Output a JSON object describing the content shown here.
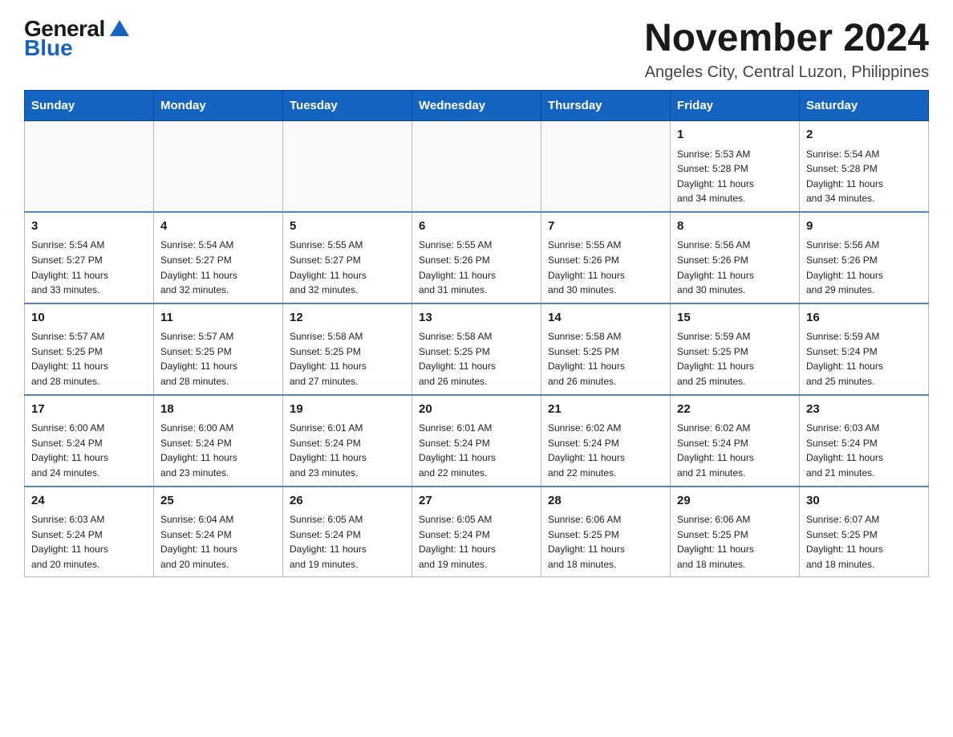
{
  "header": {
    "logo_general": "General",
    "logo_blue": "Blue",
    "main_title": "November 2024",
    "subtitle": "Angeles City, Central Luzon, Philippines"
  },
  "calendar": {
    "days_of_week": [
      "Sunday",
      "Monday",
      "Tuesday",
      "Wednesday",
      "Thursday",
      "Friday",
      "Saturday"
    ],
    "weeks": [
      [
        {
          "day": "",
          "info": ""
        },
        {
          "day": "",
          "info": ""
        },
        {
          "day": "",
          "info": ""
        },
        {
          "day": "",
          "info": ""
        },
        {
          "day": "",
          "info": ""
        },
        {
          "day": "1",
          "info": "Sunrise: 5:53 AM\nSunset: 5:28 PM\nDaylight: 11 hours\nand 34 minutes."
        },
        {
          "day": "2",
          "info": "Sunrise: 5:54 AM\nSunset: 5:28 PM\nDaylight: 11 hours\nand 34 minutes."
        }
      ],
      [
        {
          "day": "3",
          "info": "Sunrise: 5:54 AM\nSunset: 5:27 PM\nDaylight: 11 hours\nand 33 minutes."
        },
        {
          "day": "4",
          "info": "Sunrise: 5:54 AM\nSunset: 5:27 PM\nDaylight: 11 hours\nand 32 minutes."
        },
        {
          "day": "5",
          "info": "Sunrise: 5:55 AM\nSunset: 5:27 PM\nDaylight: 11 hours\nand 32 minutes."
        },
        {
          "day": "6",
          "info": "Sunrise: 5:55 AM\nSunset: 5:26 PM\nDaylight: 11 hours\nand 31 minutes."
        },
        {
          "day": "7",
          "info": "Sunrise: 5:55 AM\nSunset: 5:26 PM\nDaylight: 11 hours\nand 30 minutes."
        },
        {
          "day": "8",
          "info": "Sunrise: 5:56 AM\nSunset: 5:26 PM\nDaylight: 11 hours\nand 30 minutes."
        },
        {
          "day": "9",
          "info": "Sunrise: 5:56 AM\nSunset: 5:26 PM\nDaylight: 11 hours\nand 29 minutes."
        }
      ],
      [
        {
          "day": "10",
          "info": "Sunrise: 5:57 AM\nSunset: 5:25 PM\nDaylight: 11 hours\nand 28 minutes."
        },
        {
          "day": "11",
          "info": "Sunrise: 5:57 AM\nSunset: 5:25 PM\nDaylight: 11 hours\nand 28 minutes."
        },
        {
          "day": "12",
          "info": "Sunrise: 5:58 AM\nSunset: 5:25 PM\nDaylight: 11 hours\nand 27 minutes."
        },
        {
          "day": "13",
          "info": "Sunrise: 5:58 AM\nSunset: 5:25 PM\nDaylight: 11 hours\nand 26 minutes."
        },
        {
          "day": "14",
          "info": "Sunrise: 5:58 AM\nSunset: 5:25 PM\nDaylight: 11 hours\nand 26 minutes."
        },
        {
          "day": "15",
          "info": "Sunrise: 5:59 AM\nSunset: 5:25 PM\nDaylight: 11 hours\nand 25 minutes."
        },
        {
          "day": "16",
          "info": "Sunrise: 5:59 AM\nSunset: 5:24 PM\nDaylight: 11 hours\nand 25 minutes."
        }
      ],
      [
        {
          "day": "17",
          "info": "Sunrise: 6:00 AM\nSunset: 5:24 PM\nDaylight: 11 hours\nand 24 minutes."
        },
        {
          "day": "18",
          "info": "Sunrise: 6:00 AM\nSunset: 5:24 PM\nDaylight: 11 hours\nand 23 minutes."
        },
        {
          "day": "19",
          "info": "Sunrise: 6:01 AM\nSunset: 5:24 PM\nDaylight: 11 hours\nand 23 minutes."
        },
        {
          "day": "20",
          "info": "Sunrise: 6:01 AM\nSunset: 5:24 PM\nDaylight: 11 hours\nand 22 minutes."
        },
        {
          "day": "21",
          "info": "Sunrise: 6:02 AM\nSunset: 5:24 PM\nDaylight: 11 hours\nand 22 minutes."
        },
        {
          "day": "22",
          "info": "Sunrise: 6:02 AM\nSunset: 5:24 PM\nDaylight: 11 hours\nand 21 minutes."
        },
        {
          "day": "23",
          "info": "Sunrise: 6:03 AM\nSunset: 5:24 PM\nDaylight: 11 hours\nand 21 minutes."
        }
      ],
      [
        {
          "day": "24",
          "info": "Sunrise: 6:03 AM\nSunset: 5:24 PM\nDaylight: 11 hours\nand 20 minutes."
        },
        {
          "day": "25",
          "info": "Sunrise: 6:04 AM\nSunset: 5:24 PM\nDaylight: 11 hours\nand 20 minutes."
        },
        {
          "day": "26",
          "info": "Sunrise: 6:05 AM\nSunset: 5:24 PM\nDaylight: 11 hours\nand 19 minutes."
        },
        {
          "day": "27",
          "info": "Sunrise: 6:05 AM\nSunset: 5:24 PM\nDaylight: 11 hours\nand 19 minutes."
        },
        {
          "day": "28",
          "info": "Sunrise: 6:06 AM\nSunset: 5:25 PM\nDaylight: 11 hours\nand 18 minutes."
        },
        {
          "day": "29",
          "info": "Sunrise: 6:06 AM\nSunset: 5:25 PM\nDaylight: 11 hours\nand 18 minutes."
        },
        {
          "day": "30",
          "info": "Sunrise: 6:07 AM\nSunset: 5:25 PM\nDaylight: 11 hours\nand 18 minutes."
        }
      ]
    ]
  }
}
